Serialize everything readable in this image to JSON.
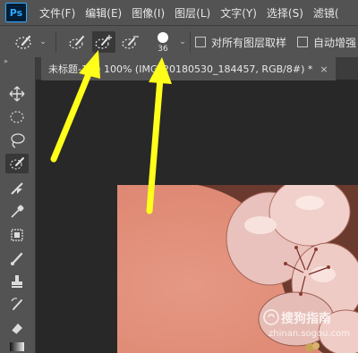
{
  "app": {
    "logo": "Ps"
  },
  "menu": {
    "items": [
      "文件(F)",
      "编辑(E)",
      "图像(I)",
      "图层(L)",
      "文字(Y)",
      "选择(S)",
      "滤镜("
    ]
  },
  "options": {
    "brush_size": "36",
    "sample_all_layers_label": "对所有图层取样",
    "auto_enhance_label": "自动增强"
  },
  "document": {
    "tab_label": "未标题-1 @ 100% (IMG_20180530_184457, RGB/8#) *",
    "close_glyph": "×"
  },
  "tools": {
    "panel_grip": "»",
    "items": [
      "move-tool",
      "elliptical-marquee-tool",
      "lasso-tool",
      "quick-selection-tool",
      "eyedropper-tool",
      "brush-tool",
      "patch-tool",
      "paint-brush-tool",
      "clone-stamp-tool",
      "history-brush-tool",
      "eraser-tool",
      "gradient-tool"
    ]
  },
  "watermark": {
    "text": "搜狗指南",
    "url": "zhinan.sogou.com"
  },
  "colors": {
    "ui_dark": "#535353",
    "workspace": "#282828",
    "canvas": "#e08c77",
    "annotation": "#ffff1a"
  }
}
